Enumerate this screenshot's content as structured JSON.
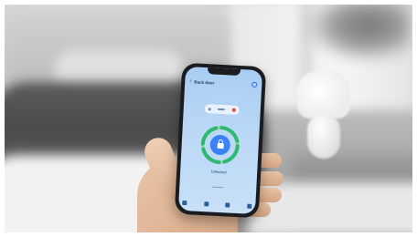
{
  "phone_app": {
    "title": "Back door",
    "back_glyph": "‹",
    "state_label": "Unlocked",
    "status_time": "",
    "ring_color": "#2fb86f",
    "accent_color": "#3b82f6",
    "icons": [
      "back-arrow-icon",
      "settings-icon",
      "lock-icon"
    ],
    "nav_items": [
      "home",
      "devices",
      "automation",
      "account"
    ]
  }
}
